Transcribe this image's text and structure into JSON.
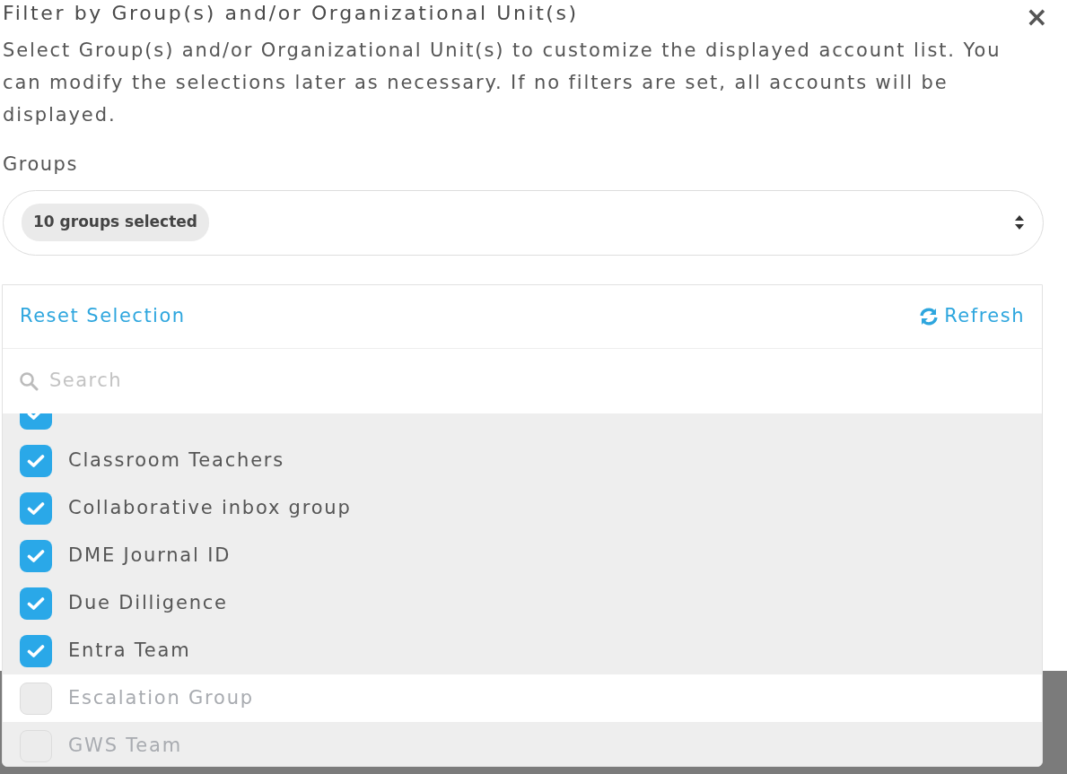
{
  "dialog": {
    "title": "Filter by Group(s) and/or Organizational Unit(s)",
    "close": "×",
    "description": "Select Group(s) and/or Organizational Unit(s) to customize the displayed account list. You can modify the selections later as necessary. If no filters are set, all accounts will be displayed."
  },
  "groups_field": {
    "label": "Groups",
    "chip": "10 groups selected"
  },
  "dropdown": {
    "reset": "Reset Selection",
    "refresh": "Refresh",
    "search": {
      "placeholder": "Search"
    },
    "items": [
      {
        "checked": true,
        "hovered": false
      },
      {
        "label": "Classroom Teachers",
        "checked": true,
        "hovered": false
      },
      {
        "label": "Collaborative inbox group",
        "checked": true,
        "hovered": false
      },
      {
        "label": "DME Journal ID",
        "checked": true,
        "hovered": false
      },
      {
        "label": "Due Dilligence",
        "checked": true,
        "hovered": false
      },
      {
        "label": "Entra Team",
        "checked": true,
        "hovered": false
      },
      {
        "label": "Escalation Group",
        "checked": false,
        "hovered": false
      },
      {
        "label": "GWS Team",
        "checked": false,
        "hovered": true
      }
    ]
  }
}
